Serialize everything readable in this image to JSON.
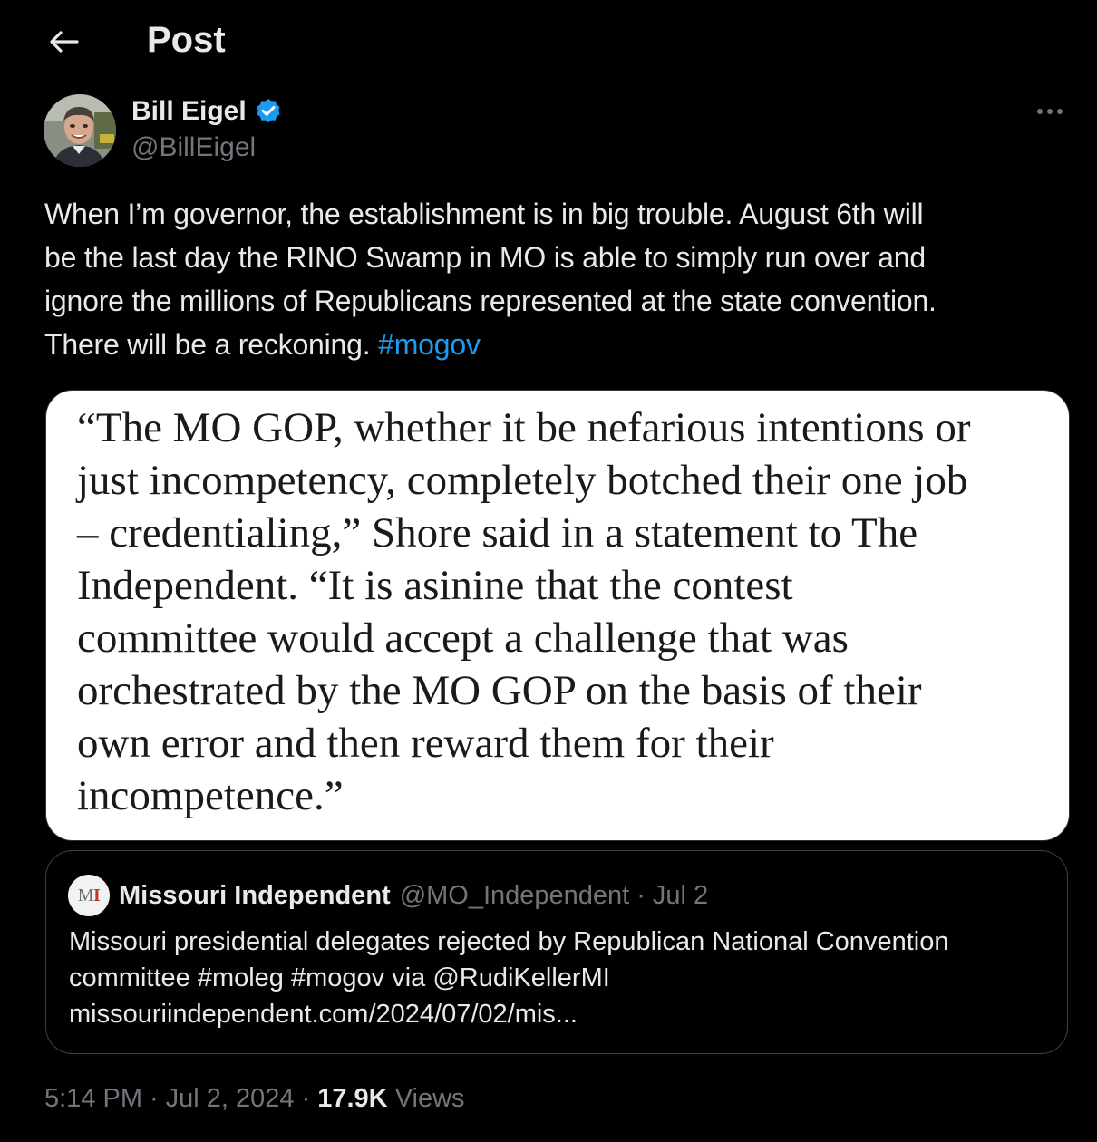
{
  "header": {
    "title": "Post"
  },
  "author": {
    "display_name": "Bill Eigel",
    "handle": "@BillEigel",
    "verified": true,
    "verified_color": "#1d9bf0"
  },
  "tweet": {
    "lines": [
      "When I’m governor, the establishment is in big trouble.  August 6th will",
      "be the last day the RINO Swamp in MO is able to simply run over and",
      "ignore the millions of Republicans represented at the state convention.",
      "There will be a reckoning. "
    ],
    "hashtag": "#mogov",
    "link_color": "#1d9bf0"
  },
  "media": {
    "lines": [
      "“The MO GOP, whether it be nefarious intentions or",
      "just incompetency, completely botched their one job",
      "– credentialing,” Shore said in a statement to The",
      "Independent. “It is asinine that the contest",
      "committee would accept a challenge that was",
      "orchestrated by the MO GOP on the basis of their",
      "own error and then reward them for their",
      "incompetence.”"
    ]
  },
  "quote": {
    "avatar_letters": {
      "m": "M",
      "i": "I"
    },
    "name": "Missouri Independent",
    "handle": "@MO_Independent",
    "separator": "·",
    "date": "Jul 2",
    "lines": [
      "Missouri presidential delegates rejected by Republican National Convention",
      "committee #moleg #mogov via @RudiKellerMI",
      "missouriindependent.com/2024/07/02/mis..."
    ]
  },
  "meta": {
    "time": "5:14 PM",
    "separator": "·",
    "date": "Jul 2, 2024",
    "views_count": "17.9K",
    "views_label": "Views"
  }
}
